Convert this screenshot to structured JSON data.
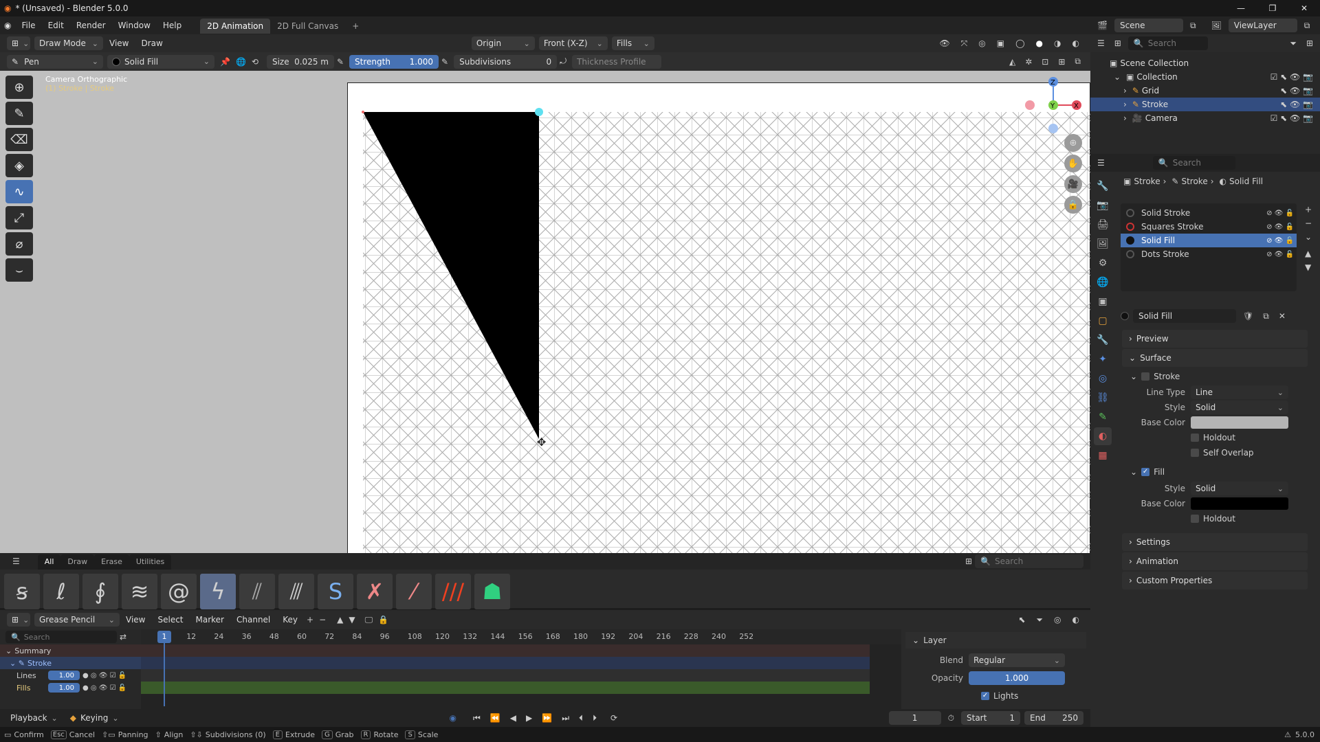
{
  "title": "* (Unsaved) - Blender 5.0.0",
  "menu": [
    "File",
    "Edit",
    "Render",
    "Window",
    "Help"
  ],
  "workspaces": [
    "2D Animation",
    "2D Full Canvas"
  ],
  "header": {
    "mode": "Draw Mode",
    "view": "View",
    "draw": "Draw",
    "origin": "Origin",
    "orient": "Front (X-Z)",
    "fills": "Fills"
  },
  "tools": {
    "brush": "Pen",
    "material": "Solid Fill",
    "size_label": "Size",
    "size_value": "0.025 m",
    "strength_label": "Strength",
    "strength_value": "1.000",
    "subdiv_label": "Subdivisions",
    "subdiv_value": "0",
    "thickness": "Thickness Profile"
  },
  "viewport": {
    "camera": "Camera Orthographic",
    "context": "(1) Stroke | Stroke"
  },
  "assets": {
    "tabs": [
      "All",
      "Draw",
      "Erase",
      "Utilities"
    ],
    "search": "Search"
  },
  "timeline": {
    "editor": "Grease Pencil",
    "menus": [
      "View",
      "Select",
      "Marker",
      "Channel",
      "Key"
    ],
    "search": "Search",
    "frames": [
      "1",
      "12",
      "24",
      "36",
      "48",
      "60",
      "72",
      "84",
      "96",
      "108",
      "120",
      "132",
      "144",
      "156",
      "168",
      "180",
      "192",
      "204",
      "216",
      "228",
      "240",
      "252"
    ],
    "summary": "Summary",
    "object": "Stroke",
    "layers": [
      {
        "name": "Lines",
        "value": "1.00"
      },
      {
        "name": "Fills",
        "value": "1.00"
      }
    ],
    "panel": {
      "title": "Layer",
      "blend_label": "Blend",
      "blend_value": "Regular",
      "opacity_label": "Opacity",
      "opacity_value": "1.000",
      "lights": "Lights"
    }
  },
  "playback": {
    "playback": "Playback",
    "keying": "Keying",
    "current": "1",
    "start_label": "Start",
    "start": "1",
    "end_label": "End",
    "end": "250"
  },
  "status": [
    "Confirm",
    "Cancel",
    "Panning",
    "Align",
    "Subdivisions (0)",
    "Extrude",
    "Grab",
    "Rotate",
    "Scale"
  ],
  "status_keys": [
    "Esc",
    "E",
    "G",
    "R",
    "S"
  ],
  "version": "5.0.0",
  "outliner": {
    "scene": "Scene",
    "viewlayer": "ViewLayer",
    "search": "Search",
    "root": "Scene Collection",
    "collection": "Collection",
    "items": [
      "Grid",
      "Stroke",
      "Camera"
    ]
  },
  "properties": {
    "search": "Search",
    "breadcrumb": [
      "Stroke",
      "Stroke",
      "Solid Fill"
    ],
    "slots": [
      {
        "name": "Solid Stroke",
        "color": "#222222"
      },
      {
        "name": "Squares Stroke",
        "color": "#cc3333"
      },
      {
        "name": "Solid Fill",
        "color": "#111111"
      },
      {
        "name": "Dots Stroke",
        "color": "#222222"
      }
    ],
    "material_name": "Solid Fill",
    "sections": {
      "preview": "Preview",
      "surface": "Surface",
      "stroke": "Stroke",
      "fill": "Fill",
      "settings": "Settings",
      "animation": "Animation",
      "custom": "Custom Properties"
    },
    "stroke": {
      "line_type_label": "Line Type",
      "line_type": "Line",
      "style_label": "Style",
      "style": "Solid",
      "base_color_label": "Base Color",
      "holdout": "Holdout",
      "self_overlap": "Self Overlap"
    },
    "fill": {
      "style_label": "Style",
      "style": "Solid",
      "base_color_label": "Base Color",
      "holdout": "Holdout"
    }
  },
  "colors": {
    "accent": "#4772b3",
    "stroke_base": "#b4b4b4",
    "fill_base": "#000000"
  }
}
